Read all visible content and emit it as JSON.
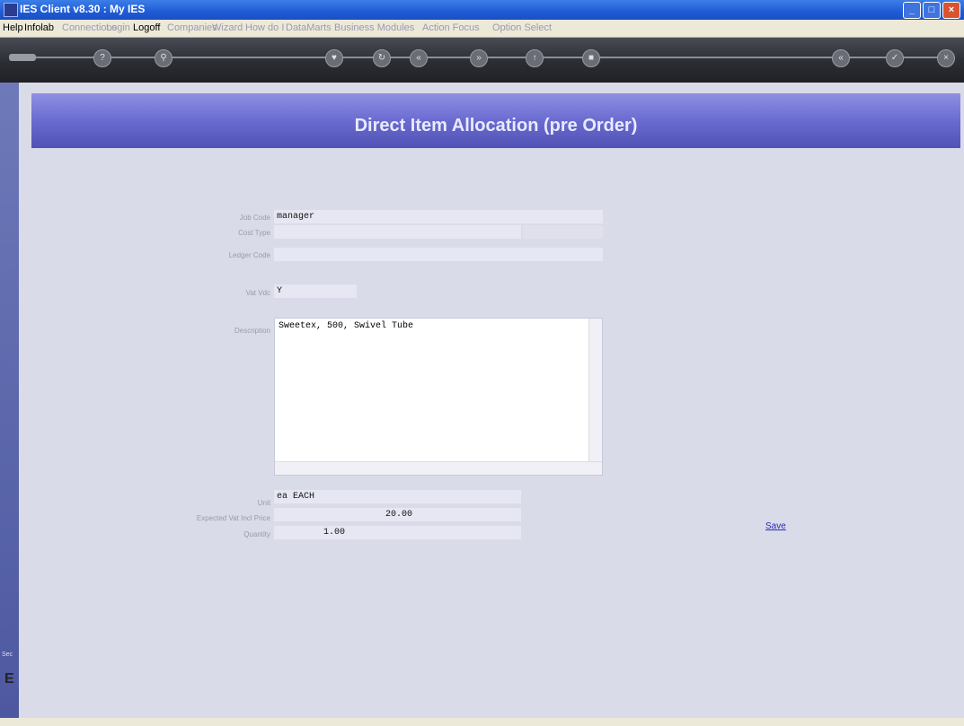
{
  "window": {
    "title": "IES Client v8.30 : My IES"
  },
  "menu": [
    {
      "label": "Help",
      "dim": false
    },
    {
      "label": "Infolab",
      "dim": false
    },
    {
      "label": "Connections",
      "dim": true
    },
    {
      "label": "Login",
      "dim": true
    },
    {
      "label": "Logoff",
      "dim": false
    },
    {
      "label": "Companies",
      "dim": true
    },
    {
      "label": "Wizard",
      "dim": true
    },
    {
      "label": "How do I",
      "dim": true
    },
    {
      "label": "DataMarts",
      "dim": true
    },
    {
      "label": "Business Modules",
      "dim": true
    },
    {
      "label": "Action Focus",
      "dim": true
    },
    {
      "label": "Option Select",
      "dim": true
    }
  ],
  "page": {
    "title": "Direct Item Allocation (pre Order)"
  },
  "form": {
    "job_code_label": "Job Code",
    "job_code_value": "manager",
    "cost_type_label": "Cost Type",
    "cost_type_value": "",
    "ledger_code_label": "Ledger Code",
    "ledger_code_value": "",
    "vat_vdc_label": "Vat Vdc",
    "vat_vdc_value": "Y",
    "description_label": "Description",
    "description_value": "Sweetex, 500, Swivel Tube",
    "unit_label": "Unit",
    "unit_value": "ea EACH",
    "expected_price_label": "Expected Vat Incl Price",
    "expected_price_value": "20.00",
    "quantity_label": "Quantity",
    "quantity_value": "1.00",
    "save_label": "Save"
  }
}
